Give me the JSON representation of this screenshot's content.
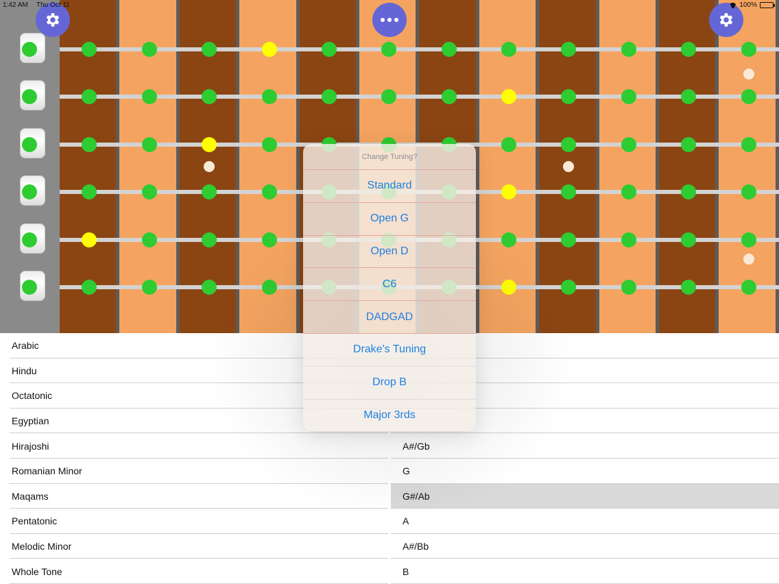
{
  "status_bar": {
    "time": "1:42 AM",
    "date": "Thu Oct 11",
    "battery": "100%",
    "battery_level_percent": 100
  },
  "toolbar": {
    "left_settings_icon": "gear-icon",
    "more_icon": "ellipsis-icon",
    "right_settings_icon": "gear-icon",
    "accent_color": "#6566d6"
  },
  "fretboard": {
    "string_count": 6,
    "colors": {
      "dark_fret": "#8b4513",
      "light_fret": "#f4a460",
      "note_dot": "#2ecc31",
      "root_dot": "#ffff00",
      "inlay": "#fbe9d7"
    }
  },
  "popover": {
    "title": "Change Tuning?",
    "options": [
      "Standard",
      "Open G",
      "Open D",
      "C6",
      "DADGAD",
      "Drake's Tuning",
      "Drop B",
      "Major 3rds"
    ]
  },
  "scales_list": [
    "Arabic",
    "Hindu",
    "Octatonic",
    "Egyptian",
    "Hirajoshi",
    "Romanian Minor",
    "Maqams",
    "Pentatonic",
    "Melodic Minor",
    "Whole Tone"
  ],
  "keys_list": [
    "",
    "",
    "",
    "",
    "A#/Gb",
    "G",
    "G#/Ab",
    "A",
    "A#/Bb",
    "B"
  ],
  "keys_selected_index": 6
}
